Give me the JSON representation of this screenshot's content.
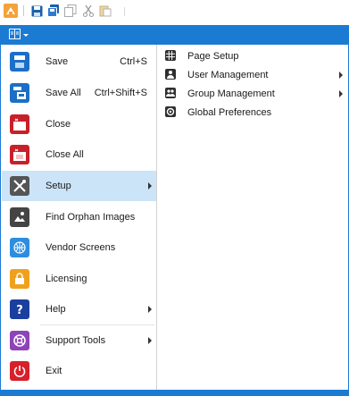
{
  "toolbar": {
    "icons": [
      "app-logo-icon",
      "save-icon",
      "save-all-icon",
      "copy-icon",
      "cut-icon",
      "paste-icon"
    ]
  },
  "file_menu": {
    "button_icon": "file-menu-icon",
    "items": [
      {
        "label": "Save",
        "shortcut": "Ctrl+S",
        "icon": "save-icon",
        "color": "#1b6fc7"
      },
      {
        "label": "Save All",
        "shortcut": "Ctrl+Shift+S",
        "icon": "save-all-icon",
        "color": "#1b6fc7"
      },
      {
        "label": "Close",
        "icon": "close-file-icon",
        "color": "#c8202a"
      },
      {
        "label": "Close All",
        "icon": "close-all-icon",
        "color": "#c8202a"
      },
      {
        "label": "Setup",
        "icon": "tools-icon",
        "color": "#555555",
        "submenu": true,
        "active": true
      },
      {
        "label": "Find Orphan Images",
        "icon": "find-images-icon",
        "color": "#444444"
      },
      {
        "label": "Vendor Screens",
        "icon": "globe-grid-icon",
        "color": "#2d8ee0"
      },
      {
        "label": "Licensing",
        "icon": "lock-icon",
        "color": "#f0a11c"
      },
      {
        "label": "Help",
        "icon": "help-icon",
        "color": "#1b3f9e",
        "submenu": true
      },
      {
        "label": "Support Tools",
        "icon": "lifebuoy-icon",
        "color": "#8e44b8",
        "submenu": true
      },
      {
        "label": "Exit",
        "icon": "power-icon",
        "color": "#d8202a"
      }
    ]
  },
  "setup_submenu": {
    "items": [
      {
        "label": "Page Setup",
        "icon": "grid-icon"
      },
      {
        "label": "User Management",
        "icon": "user-icon",
        "submenu": true
      },
      {
        "label": "Group Management",
        "icon": "group-icon",
        "submenu": true
      },
      {
        "label": "Global Preferences",
        "icon": "preferences-icon"
      }
    ]
  },
  "colors": {
    "accent": "#1b7bd3",
    "highlight": "#cce4f7"
  }
}
